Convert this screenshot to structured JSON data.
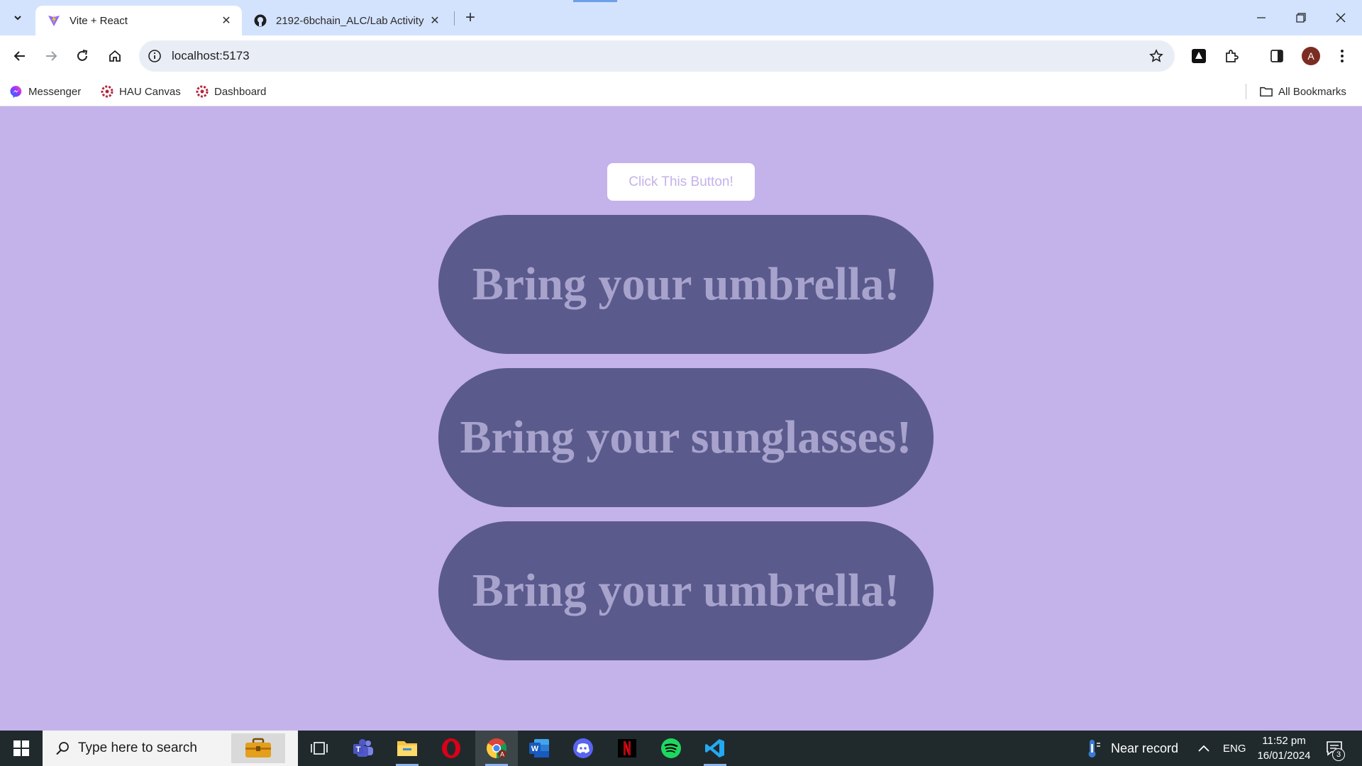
{
  "browser": {
    "tabs": [
      {
        "title": "Vite + React",
        "favicon": "vite-logo",
        "active": true
      },
      {
        "title": "2192-6bchain_ALC/Lab Activity",
        "favicon": "github-logo",
        "active": false
      }
    ],
    "url": "localhost:5173",
    "profile_initial": "A",
    "bookmarks": [
      {
        "label": "Messenger",
        "icon": "messenger-icon"
      },
      {
        "label": "HAU Canvas",
        "icon": "canvas-icon"
      },
      {
        "label": "Dashboard",
        "icon": "canvas-icon"
      }
    ],
    "all_bookmarks_label": "All Bookmarks"
  },
  "page": {
    "button_label": "Click This Button!",
    "messages": [
      "Bring your umbrella!",
      "Bring your sunglasses!",
      "Bring your umbrella!"
    ],
    "colors": {
      "background": "#c4b2eb",
      "pill": "#5b5a8d",
      "pill_text": "#a7a3cc",
      "button_bg": "#ffffff",
      "button_text": "#c4b2eb"
    }
  },
  "taskbar": {
    "search_placeholder": "Type here to search",
    "weather": "Near record",
    "language": "ENG",
    "time": "11:52 pm",
    "date": "16/01/2024",
    "notification_count": "3",
    "apps": [
      "task-view",
      "teams",
      "file-explorer",
      "opera",
      "chrome",
      "word",
      "discord",
      "netflix",
      "spotify",
      "vscode"
    ]
  }
}
